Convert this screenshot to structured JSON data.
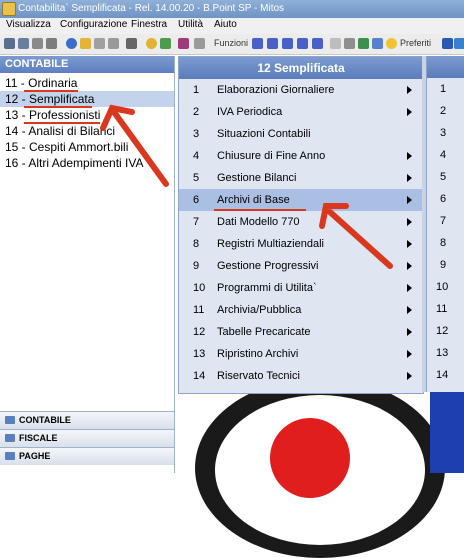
{
  "window": {
    "title": "Contabilita` Semplificata - Rel. 14.00.20 - B.Point SP - Mitos"
  },
  "menubar": {
    "items": [
      "Visualizza",
      "Configurazione",
      "Finestra",
      "Utilità",
      "Aiuto"
    ]
  },
  "toolbar": {
    "funzioni_label": "Funzioni",
    "preferiti_label": "Preferiti"
  },
  "left_panel": {
    "header": "CONTABILE",
    "items": [
      {
        "label": "11 - Ordinaria"
      },
      {
        "label": "12 - Semplificata",
        "selected": true
      },
      {
        "label": "13 - Professionisti"
      },
      {
        "label": "14 - Analisi di Bilanci"
      },
      {
        "label": "15 - Cespiti Ammort.bili"
      },
      {
        "label": "16 - Altri Adempimenti IVA"
      }
    ],
    "accordion": [
      "CONTABILE",
      "FISCALE",
      "PAGHE"
    ]
  },
  "submenu": {
    "title": "12 Semplificata",
    "items": [
      {
        "num": "1",
        "label": "Elaborazioni Giornaliere",
        "arrow": true
      },
      {
        "num": "2",
        "label": "IVA Periodica",
        "arrow": true
      },
      {
        "num": "3",
        "label": "Situazioni Contabili",
        "arrow": false
      },
      {
        "num": "4",
        "label": "Chiusure di Fine Anno",
        "arrow": true
      },
      {
        "num": "5",
        "label": "Gestione Bilanci",
        "arrow": true
      },
      {
        "num": "6",
        "label": "Archivi di Base",
        "arrow": true,
        "selected": true
      },
      {
        "num": "7",
        "label": "Dati Modello 770",
        "arrow": true
      },
      {
        "num": "8",
        "label": "Registri Multiaziendali",
        "arrow": true
      },
      {
        "num": "9",
        "label": "Gestione Progressivi",
        "arrow": true
      },
      {
        "num": "10",
        "label": "Programmi di Utilita`",
        "arrow": true
      },
      {
        "num": "11",
        "label": "Archivia/Pubblica",
        "arrow": true
      },
      {
        "num": "12",
        "label": "Tabelle Precaricate",
        "arrow": true
      },
      {
        "num": "13",
        "label": "Ripristino Archivi",
        "arrow": true
      },
      {
        "num": "14",
        "label": "Riservato Tecnici",
        "arrow": true
      }
    ]
  },
  "second_panel": {
    "numbers": [
      "1",
      "2",
      "3",
      "4",
      "5",
      "6",
      "7",
      "8",
      "9",
      "10",
      "11",
      "12",
      "13",
      "14"
    ]
  },
  "colors": {
    "header_blue": "#5d7fbf",
    "selection": "#c4d3ec",
    "annotation_red": "#d9381e"
  }
}
